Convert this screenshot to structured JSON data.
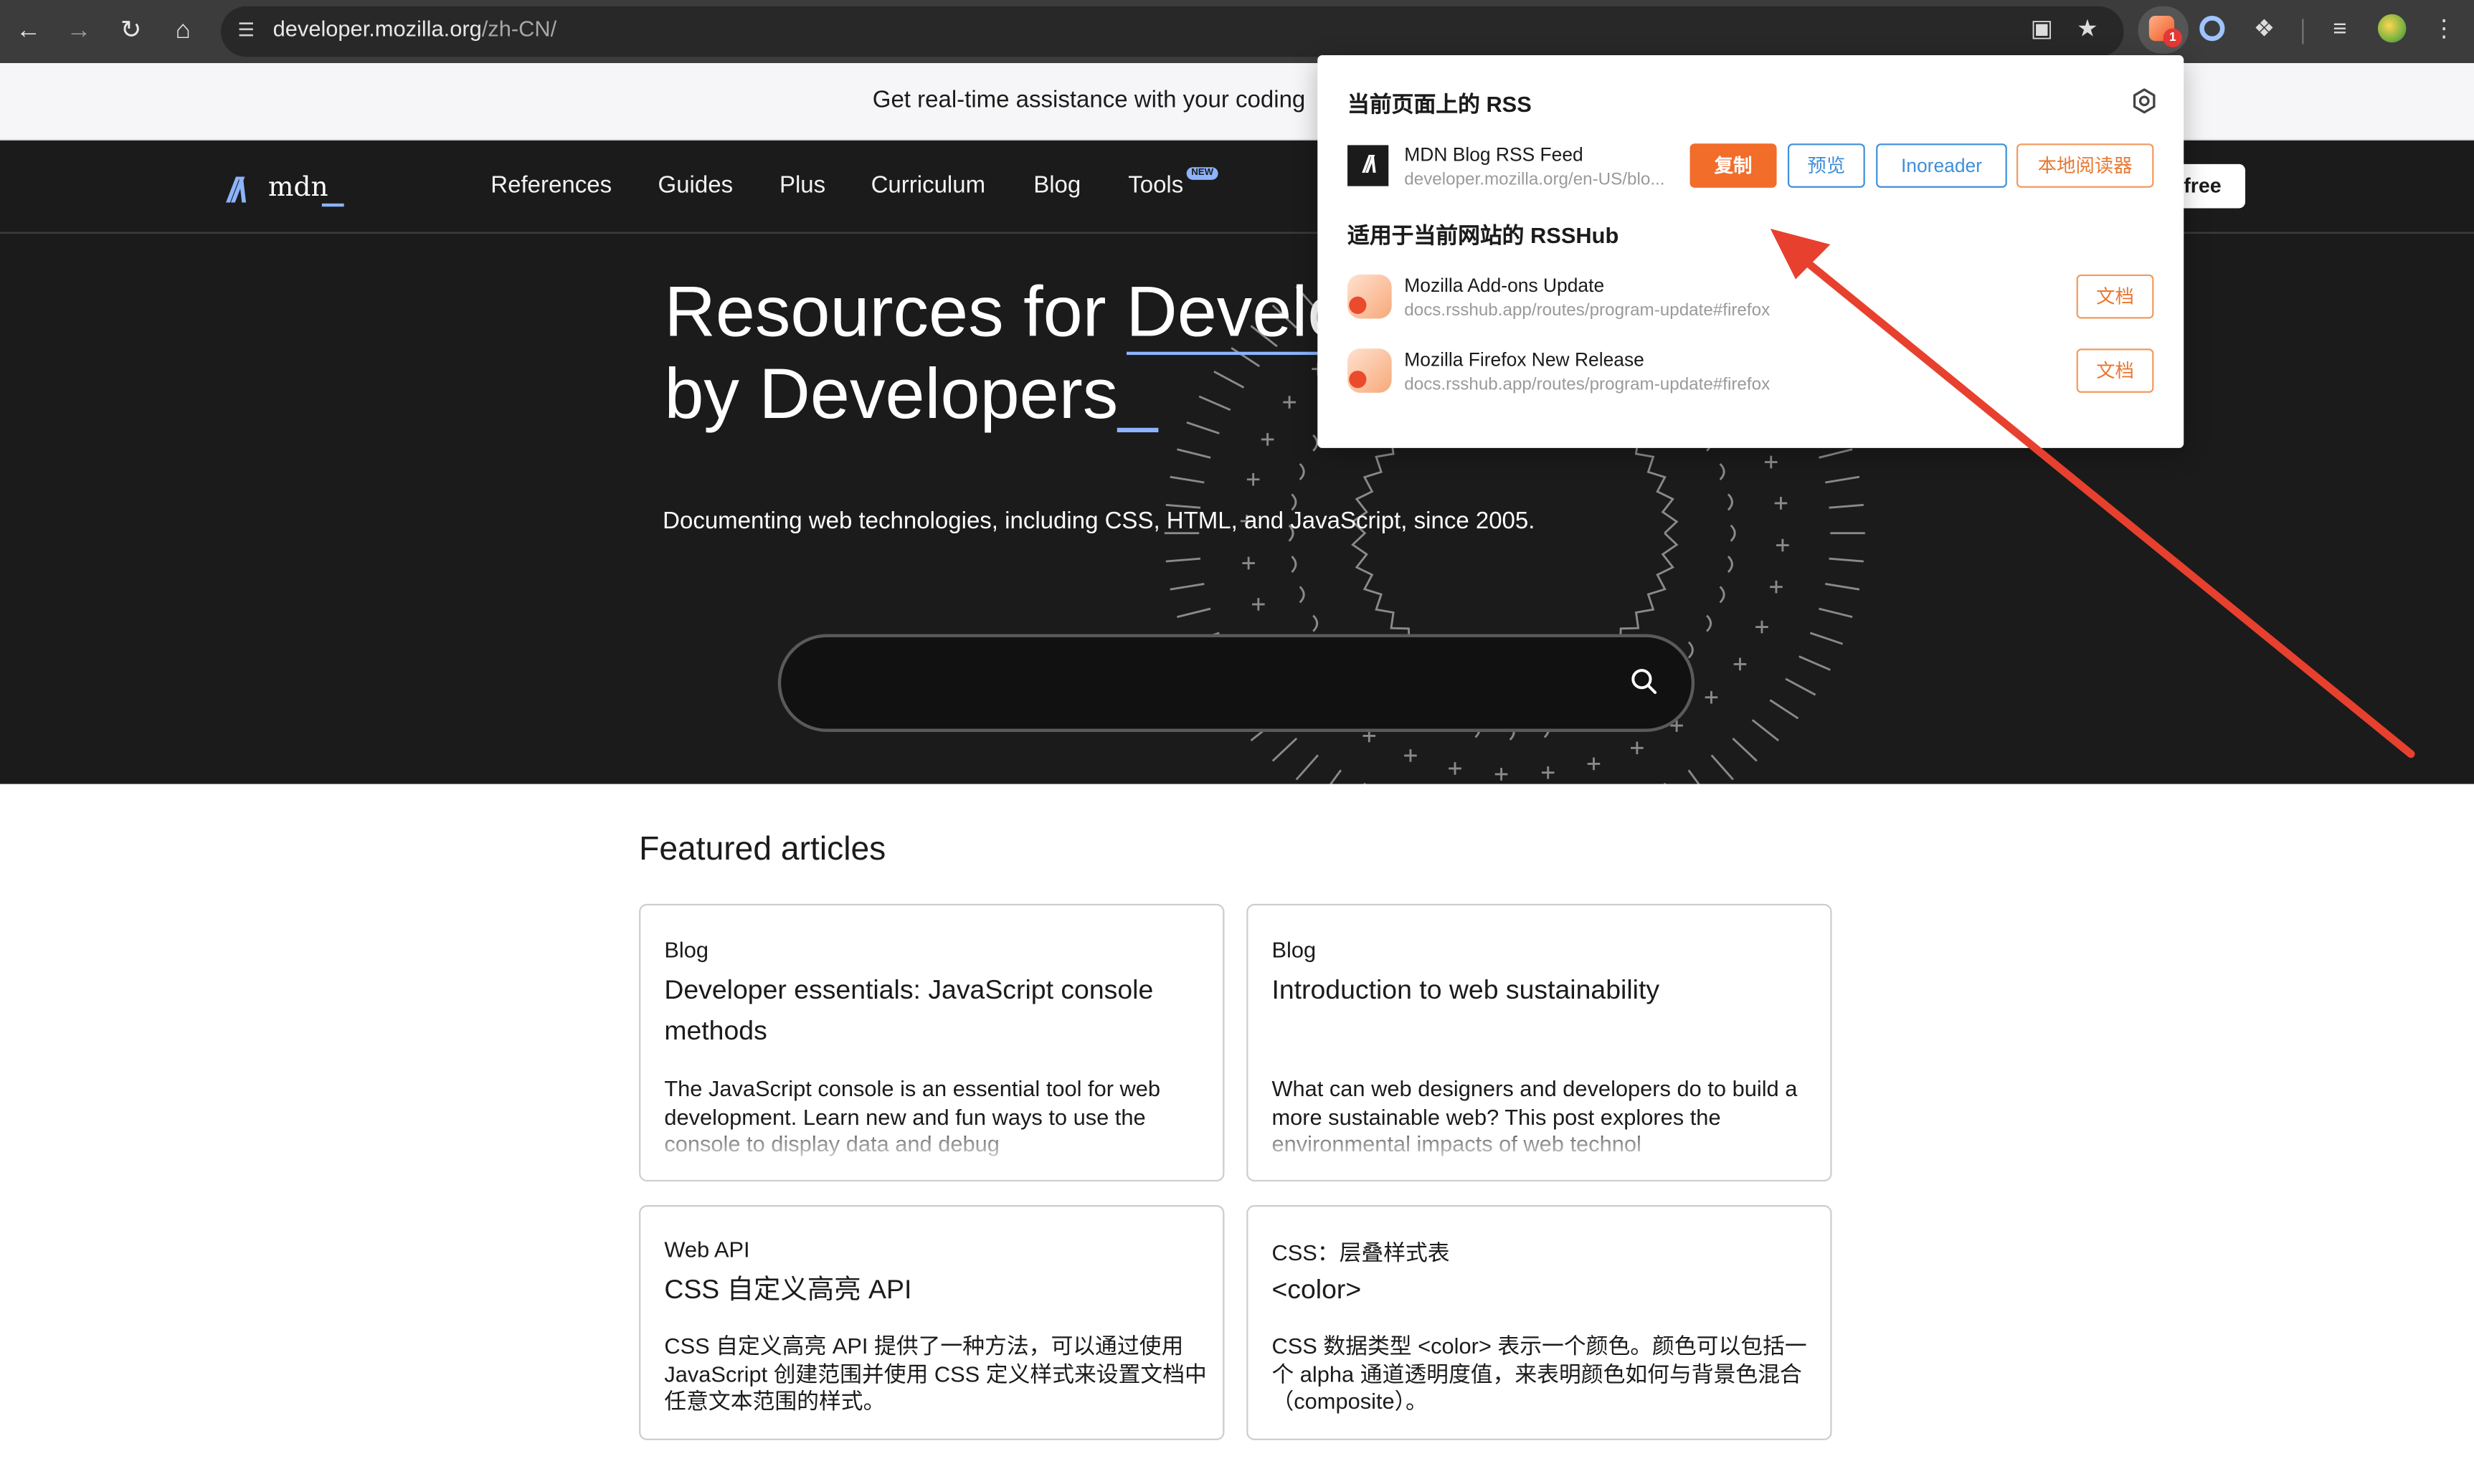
{
  "browser": {
    "url_host": "developer.mozilla.org",
    "url_path": "/zh-CN/",
    "ext_badge_count": "1"
  },
  "banner": {
    "text": "Get real-time assistance with your coding"
  },
  "header": {
    "logo_text": "mdn",
    "nav": [
      "References",
      "Guides",
      "Plus",
      "Curriculum",
      "Blog",
      "Tools"
    ],
    "new_badge": "NEW",
    "free_button": "free"
  },
  "hero": {
    "title_line1_prefix": "Resources for ",
    "title_line1_link": "Develo",
    "title_line2": "by Developers",
    "cursor": "_",
    "subtitle": "Documenting web technologies, including CSS, HTML, and JavaScript, since 2005."
  },
  "rss_popup": {
    "section1_title": "当前页面上的 RSS",
    "feed": {
      "title": "MDN Blog RSS Feed",
      "url": "developer.mozilla.org/en-US/blo...",
      "copy_label": "复制",
      "preview_label": "预览",
      "inoreader_label": "Inoreader",
      "local_reader_label": "本地阅读器"
    },
    "section2_title": "适用于当前网站的 RSSHub",
    "rsshub": [
      {
        "title": "Mozilla Add-ons Update",
        "url": "docs.rsshub.app/routes/program-update#firefox",
        "doc_label": "文档"
      },
      {
        "title": "Mozilla Firefox New Release",
        "url": "docs.rsshub.app/routes/program-update#firefox",
        "doc_label": "文档"
      }
    ]
  },
  "featured": {
    "heading": "Featured articles",
    "cards": [
      {
        "category": "Blog",
        "title": "Developer essentials: JavaScript console methods",
        "desc": "The JavaScript console is an essential tool for web development. Learn new and fun ways to use the console to display data and debug"
      },
      {
        "category": "Blog",
        "title": "Introduction to web sustainability",
        "desc": "What can web designers and developers do to build a more sustainable web? This post explores the environmental impacts of web technol"
      },
      {
        "category": "Web API",
        "title": "CSS 自定义高亮 API",
        "desc": "CSS 自定义高亮 API 提供了一种方法，可以通过使用 JavaScript 创建范围并使用 CSS 定义样式来设置文档中任意文本范围的样式。"
      },
      {
        "category": "CSS：层叠样式表",
        "title": "<color>",
        "desc": "CSS 数据类型 <color> 表示一个颜色。颜色可以包括一个 alpha 通道透明度值，来表明颜色如何与背景色混合（composite）。"
      }
    ]
  },
  "colors": {
    "mdn_accent": "#8cb4ff",
    "rss_orange": "#f26c2a",
    "link_blue": "#3f8fd9",
    "annotation_red": "#e8402e"
  }
}
